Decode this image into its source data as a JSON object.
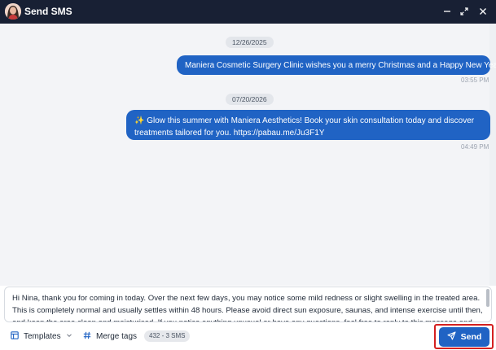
{
  "window": {
    "title": "Send SMS",
    "controls": [
      "minimize-icon",
      "expand-icon",
      "close-icon"
    ]
  },
  "messages": [
    {
      "date": "12/26/2025",
      "text": "Maniera Cosmetic Surgery Clinic wishes you a merry Christmas and a Happy New Year ??",
      "time": "03:55 PM"
    },
    {
      "date": "07/20/2026",
      "text_line1": "✨ Glow this summer with Maniera Aesthetics! Book your skin consultation today and discover",
      "text_line2": "treatments tailored for you. https://pabau.me/Ju3F1Y",
      "time": "04:49 PM"
    }
  ],
  "composer": {
    "value": "Hi Nina, thank you for coming in today. Over the next few days, you may notice some mild redness or slight swelling in the treated area. This is completely normal and usually settles within 48 hours. Please avoid direct sun exposure, saunas, and intense exercise until then, and keep the area clean and moisturised. If you notice anything unusual or have any questions, feel free to reply to this message and we'll be"
  },
  "footer": {
    "templates_label": "Templates",
    "merge_tags_label": "Merge tags",
    "count": "432 - 3 SMS",
    "send_label": "Send"
  },
  "colors": {
    "titlebar": "#182034",
    "accent": "#2063c4",
    "highlight_outline": "#d42020"
  }
}
